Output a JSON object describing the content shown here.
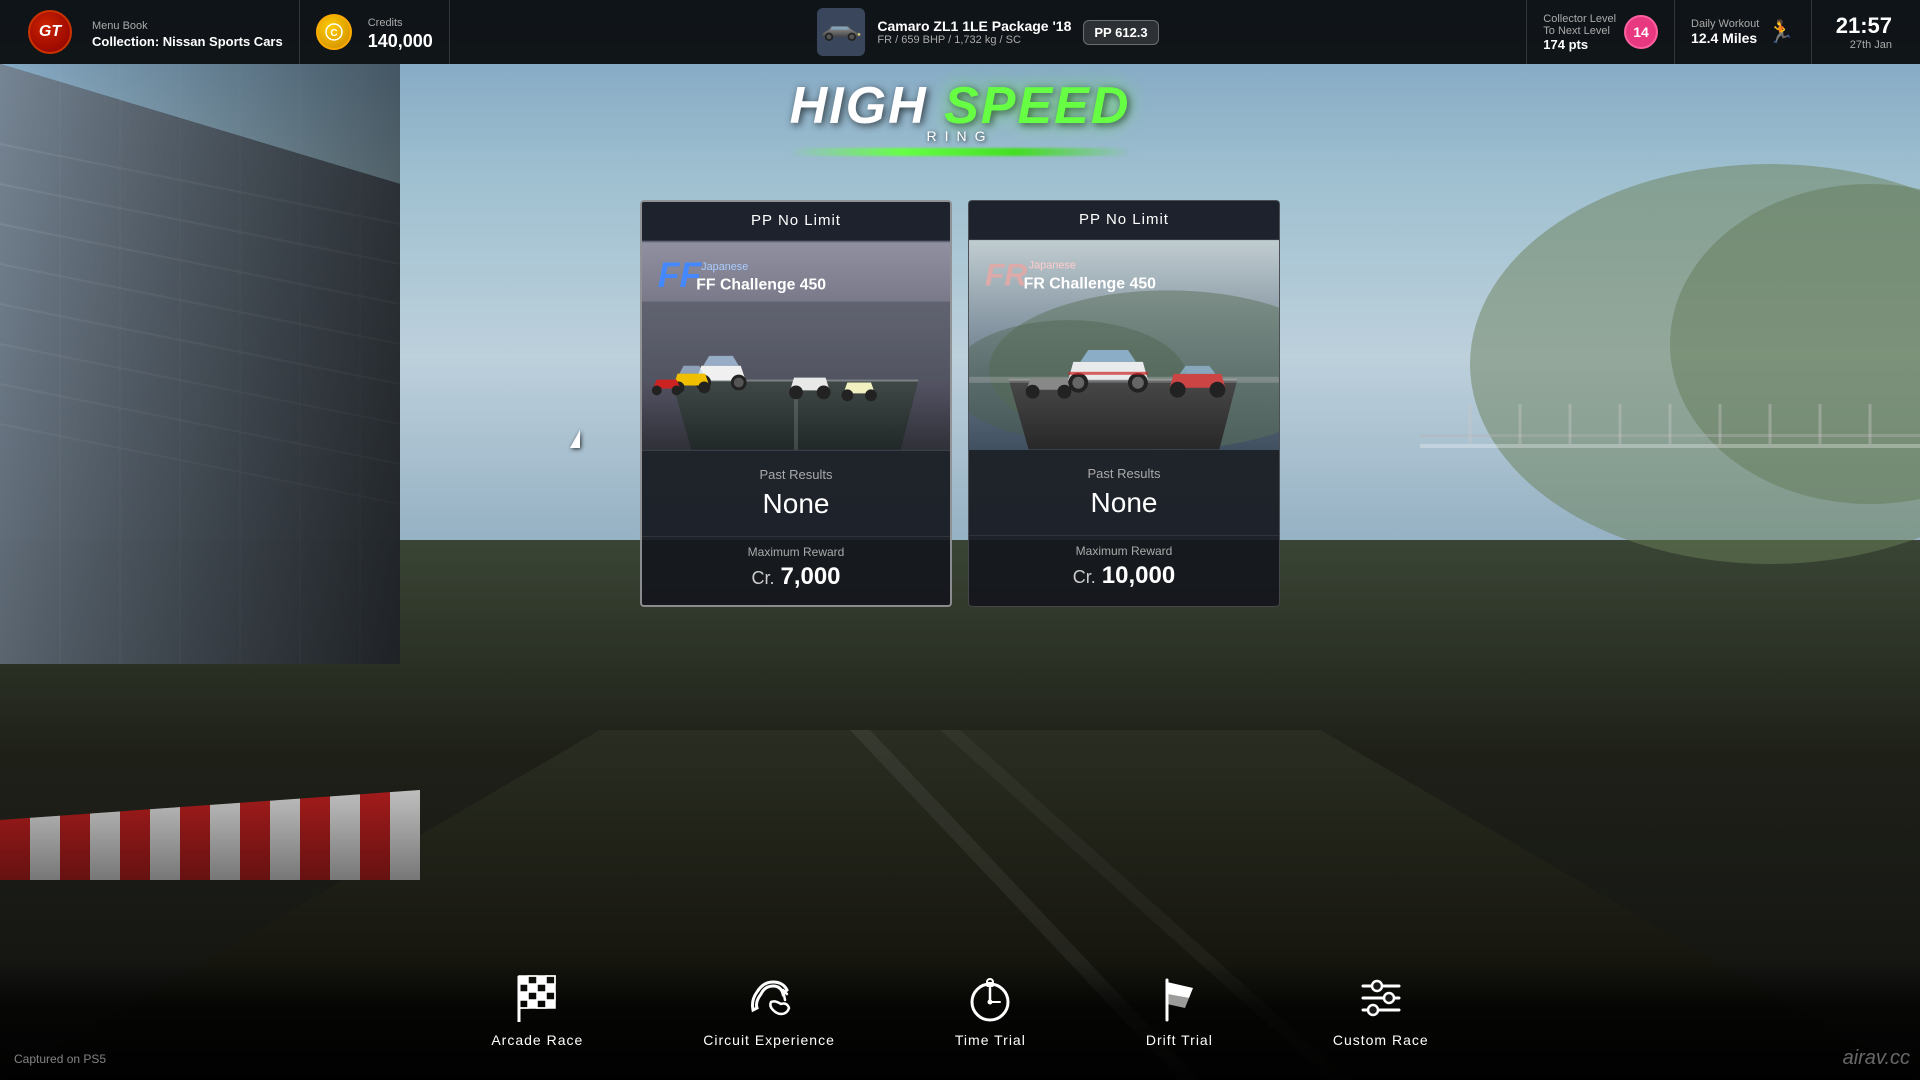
{
  "header": {
    "gt_logo": "GT",
    "menu_book_label": "Menu Book",
    "menu_book_sub": "Collection: Nissan Sports Cars",
    "credits_label": "Credits",
    "credits_value": "140,000",
    "car_name": "Camaro ZL1 1LE Package '18",
    "car_specs": "FR / 659 BHP / 1,732 kg / SC",
    "pp_value": "PP 612.3",
    "collector_label": "Collector Level",
    "collector_sub": "To Next Level",
    "collector_pts": "174 pts",
    "collector_level": "14",
    "workout_label": "Daily Workout",
    "workout_value": "12.4 Miles",
    "time": "21:57",
    "date": "27th Jan"
  },
  "track": {
    "name_high": "HIGH",
    "name_speed": "SPEED",
    "name_ring": "RING"
  },
  "cards": [
    {
      "id": "ff-challenge",
      "pp_limit": "PP No Limit",
      "challenge_type": "FF",
      "challenge_label": "Japanese",
      "challenge_name": "FF Challenge 450",
      "past_results_label": "Past Results",
      "past_results_value": "None",
      "max_reward_label": "Maximum Reward",
      "max_reward_prefix": "Cr.",
      "max_reward_value": "7,000"
    },
    {
      "id": "fr-challenge",
      "pp_limit": "PP No Limit",
      "challenge_type": "FR",
      "challenge_label": "Japanese",
      "challenge_name": "FR Challenge 450",
      "past_results_label": "Past Results",
      "past_results_value": "None",
      "max_reward_label": "Maximum Reward",
      "max_reward_prefix": "Cr.",
      "max_reward_value": "10,000"
    }
  ],
  "bottom_nav": [
    {
      "id": "arcade-race",
      "icon": "checkered",
      "label": "Arcade Race"
    },
    {
      "id": "circuit-experience",
      "icon": "circuit",
      "label": "Circuit Experience"
    },
    {
      "id": "time-trial",
      "icon": "timer",
      "label": "Time Trial"
    },
    {
      "id": "drift-trial",
      "icon": "flag",
      "label": "Drift Trial"
    },
    {
      "id": "custom-race",
      "icon": "sliders",
      "label": "Custom Race"
    }
  ],
  "footer": {
    "captured": "Captured on PS5",
    "watermark": "airav.cc"
  }
}
